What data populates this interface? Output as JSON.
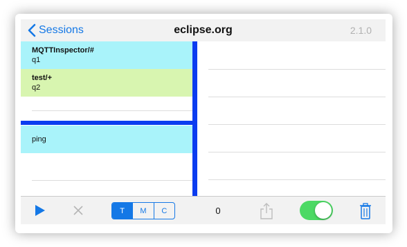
{
  "navbar": {
    "back_label": "Sessions",
    "title": "eclipse.org",
    "version": "2.1.0"
  },
  "subscriptions": [
    {
      "topic": "MQTTInspector/#",
      "qos": "q1",
      "color": "#a9f3fa"
    },
    {
      "topic": "test/+",
      "qos": "q2",
      "color": "#d8f5b0"
    }
  ],
  "publications": [
    {
      "label": "ping",
      "color": "#a9f3fa"
    }
  ],
  "toolbar": {
    "segments": [
      "T",
      "M",
      "C"
    ],
    "selected_segment": "T",
    "count": "0",
    "toggle_on": true
  },
  "colors": {
    "accent": "#1478e6",
    "separator": "#0b3cf0",
    "toggle": "#4cd964"
  }
}
